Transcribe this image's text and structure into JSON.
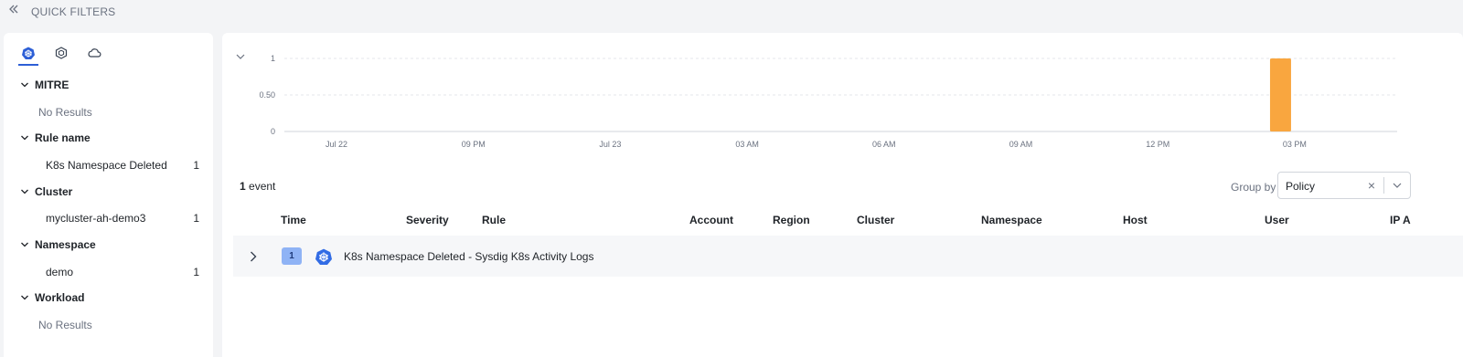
{
  "header": {
    "title": "QUICK FILTERS",
    "collapse_icon": "double-chevron-left-icon"
  },
  "filter_tabs": [
    {
      "name": "kubernetes-icon",
      "active": true
    },
    {
      "name": "hexagon-icon",
      "active": false
    },
    {
      "name": "cloud-icon",
      "active": false
    }
  ],
  "filters": {
    "mitre": {
      "title": "MITRE",
      "empty": "No Results"
    },
    "rule_name": {
      "title": "Rule name",
      "items": [
        {
          "label": "K8s Namespace Deleted",
          "count": "1"
        }
      ]
    },
    "cluster": {
      "title": "Cluster",
      "items": [
        {
          "label": "mycluster-ah-demo3",
          "count": "1"
        }
      ]
    },
    "namespace": {
      "title": "Namespace",
      "items": [
        {
          "label": "demo",
          "count": "1"
        }
      ]
    },
    "workload": {
      "title": "Workload",
      "empty": "No Results"
    }
  },
  "chart_data": {
    "type": "bar",
    "x_ticks": [
      "Jul 22",
      "09 PM",
      "Jul 23",
      "03 AM",
      "06 AM",
      "09 AM",
      "12 PM",
      "03 PM"
    ],
    "y_ticks": [
      "1",
      "0.50",
      "0"
    ],
    "ylim": [
      0,
      1
    ],
    "bars": [
      {
        "x": "Jul 23 ~02:30 PM",
        "value": 1
      }
    ],
    "bar_color": "#f9a63f",
    "grid": true
  },
  "events": {
    "count": "1",
    "count_label": "event",
    "group_by_label": "Group by",
    "group_by_value": "Policy"
  },
  "table": {
    "columns": [
      "Time",
      "Severity",
      "Rule",
      "Account",
      "Region",
      "Cluster",
      "Namespace",
      "Host",
      "User",
      "IP A"
    ],
    "rows": [
      {
        "severity": "1",
        "icon": "kubernetes-icon",
        "rule": "K8s Namespace Deleted - Sysdig K8s Activity Logs"
      }
    ]
  },
  "colors": {
    "accent": "#2d5fd6",
    "severity_badge": "#8fb3f5",
    "bar": "#f9a63f"
  }
}
